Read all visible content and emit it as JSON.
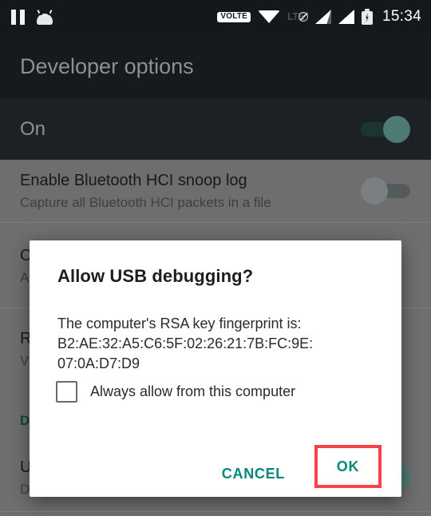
{
  "status_bar": {
    "icons": [
      "pause-icon",
      "android-head-icon",
      "volte-badge",
      "wifi-icon",
      "lte-disabled-icon",
      "signal-1-icon",
      "signal-2-icon",
      "battery-charging-icon"
    ],
    "volte_label": "VOLTE",
    "lte_label": "LTE",
    "clock": "15:34"
  },
  "app": {
    "title": "Developer options",
    "toggle_row": {
      "label": "On",
      "state": "on"
    },
    "rows": [
      {
        "title": "Enable Bluetooth HCI snoop log",
        "subtitle": "Capture all Bluetooth HCI packets in a file",
        "toggle": "off"
      },
      {
        "title": "O",
        "subtitle": "A"
      },
      {
        "title": "R",
        "subtitle": "Vi"
      },
      {
        "title": "D",
        "subtitle": ""
      },
      {
        "title": "U",
        "subtitle": "D"
      }
    ]
  },
  "dialog": {
    "title": "Allow USB debugging?",
    "message_line1": "The computer's RSA key fingerprint is:",
    "fingerprint_line1": "B2:AE:32:A5:C6:5F:02:26:21:7B:FC:9E:",
    "fingerprint_line2": "07:0A:D7:D9",
    "checkbox_label": "Always allow from this computer",
    "checkbox_checked": false,
    "cancel_label": "CANCEL",
    "ok_label": "OK"
  },
  "annotation": {
    "highlight_target": "OK",
    "highlight_color": "#f8424b"
  },
  "colors": {
    "accent_teal": "#00897a",
    "status_bar_bg": "#14181b",
    "header_bg": "#151a1d",
    "scrim_gray": "#6e6e6e",
    "dialog_bg": "#ffffff"
  }
}
